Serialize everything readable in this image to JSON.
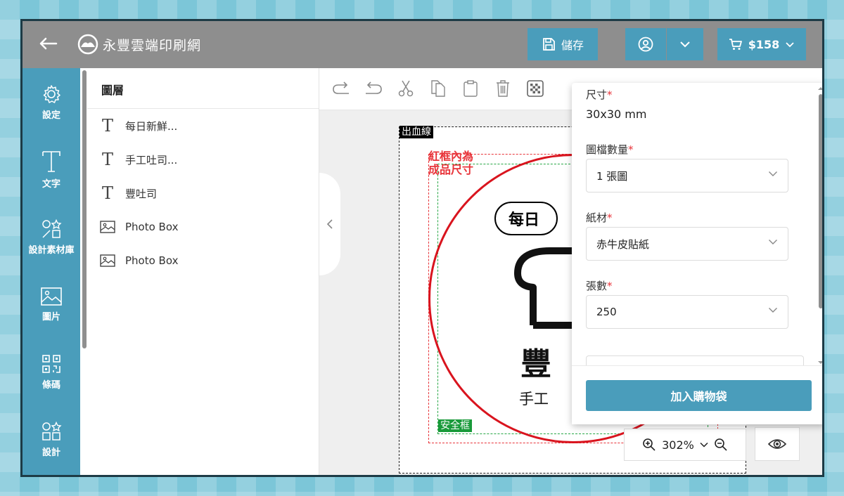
{
  "header": {
    "logo_text": "永豐雲端印刷網",
    "save_label": "儲存",
    "cart_label": "$158"
  },
  "sidebar": {
    "items": [
      {
        "label": "設定",
        "icon": "gear-icon"
      },
      {
        "label": "文字",
        "icon": "text-icon"
      },
      {
        "label": "設計素材庫",
        "icon": "shapes-icon"
      },
      {
        "label": "圖片",
        "icon": "image-icon"
      },
      {
        "label": "條碼",
        "icon": "qr-code-icon"
      },
      {
        "label": "設計",
        "icon": "shapes-icon"
      }
    ]
  },
  "layers": {
    "title": "圖層",
    "items": [
      {
        "type": "text",
        "label": "每日新鮮..."
      },
      {
        "type": "text",
        "label": "手工吐司..."
      },
      {
        "type": "text",
        "label": "豐吐司"
      },
      {
        "type": "image",
        "label": "Photo Box"
      },
      {
        "type": "image",
        "label": "Photo Box"
      }
    ]
  },
  "canvas": {
    "bleed_label": "出血線",
    "finished_note_line1": "紅框內為",
    "finished_note_line2": "成品尺寸",
    "safe_label": "安全框",
    "bubble_text": "每日",
    "big_text": "豐",
    "sub_text": "手工",
    "zoom": "302%"
  },
  "order": {
    "size_label": "尺寸",
    "size_value": "30x30 mm",
    "files_label": "圖檔數量",
    "files_value": "1 張圖",
    "material_label": "紙材",
    "material_value": "赤牛皮貼紙",
    "quantity_label": "張數",
    "quantity_value": "250",
    "add_to_cart": "加入購物袋"
  },
  "colors": {
    "accent": "#4a9dbb",
    "topbar": "#8e8e8e",
    "bleed": "#e8343a",
    "safe": "#27a745"
  }
}
